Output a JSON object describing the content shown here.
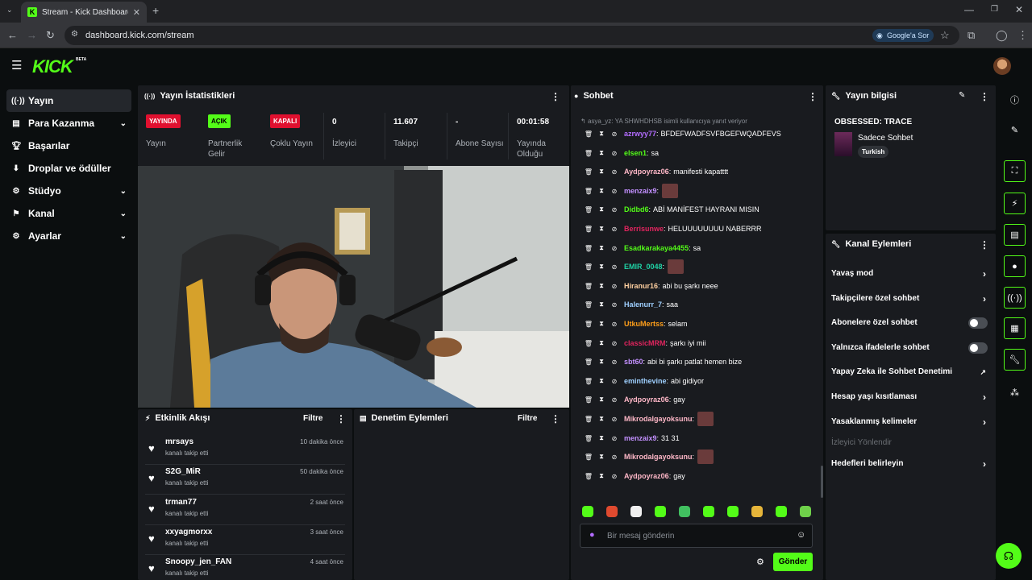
{
  "browser": {
    "tab_title": "Stream - Kick Dashboard",
    "url": "dashboard.kick.com/stream",
    "google_sor": "Google'a Sor"
  },
  "app": {
    "logo": "KICK",
    "beta": "BETA"
  },
  "sidebar": {
    "items": [
      {
        "label": "Yayın",
        "icon": "broadcast-icon"
      },
      {
        "label": "Para Kazanma",
        "icon": "money-icon"
      },
      {
        "label": "Başarılar",
        "icon": "trophy-icon"
      },
      {
        "label": "Droplar ve ödüller",
        "icon": "drops-icon"
      },
      {
        "label": "Stüdyo",
        "icon": "studio-icon"
      },
      {
        "label": "Kanal",
        "icon": "channel-icon"
      },
      {
        "label": "Ayarlar",
        "icon": "gear-icon"
      }
    ]
  },
  "stats": {
    "title": "Yayın İstatistikleri",
    "live_badge": "YAYINDA",
    "live_label": "Yayın",
    "partner_badge": "AÇIK",
    "partner_label": "Partnerlik Gelir",
    "multi_badge": "KAPALI",
    "multi_label": "Çoklu Yayın",
    "viewers": "0",
    "viewers_label": "İzleyici",
    "followers": "11.607",
    "followers_label": "Takipçi",
    "subs": "-",
    "subs_label": "Abone Sayısı",
    "uptime": "00:01:58",
    "uptime_label": "Yayında Olduğu"
  },
  "activity": {
    "title": "Etkinlik Akışı",
    "filter": "Filtre",
    "items": [
      {
        "name": "mrsays",
        "sub": "kanalı takip etti",
        "time": "10 dakika önce"
      },
      {
        "name": "S2G_MiR",
        "sub": "kanalı takip etti",
        "time": "50 dakika önce"
      },
      {
        "name": "trman77",
        "sub": "kanalı takip etti",
        "time": "2 saat önce"
      },
      {
        "name": "xxyagmorxx",
        "sub": "kanalı takip etti",
        "time": "3 saat önce"
      },
      {
        "name": "Snoopy_jen_FAN",
        "sub": "kanalı takip etti",
        "time": "4 saat önce"
      }
    ]
  },
  "moderation": {
    "title": "Denetim Eylemleri",
    "filter": "Filtre"
  },
  "chat": {
    "title": "Sohbet",
    "reply_note": "asya_yz: YA SHWHDHSB isimli kullanıcıya yanıt veriyor",
    "messages": [
      {
        "user": "azrwyy77",
        "text": "BFDEFWADFSVFBGEFWQADFEVS",
        "color": "#b36cff"
      },
      {
        "user": "elsen1",
        "text": "sa",
        "color": "#53fc18"
      },
      {
        "user": "Aydpoyraz06",
        "text": "manifesti kapatttt",
        "color": "#ffb8c8"
      },
      {
        "user": "menzaix9",
        "text": "",
        "color": "#c390ff"
      },
      {
        "user": "Didbd6",
        "text": "ABİ MANİFEST HAYRANI MISIN",
        "color": "#53fc18"
      },
      {
        "user": "Berrisunwe",
        "text": "HELUUUUUUUU NABERRR",
        "color": "#e0245e"
      },
      {
        "user": "Esadkarakaya4455",
        "text": "sa",
        "color": "#53fc18"
      },
      {
        "user": "EMIR_0048",
        "text": "",
        "color": "#1fd1a5"
      },
      {
        "user": "Hiranur16",
        "text": "abi bu şarkı neee",
        "color": "#ffd0a0"
      },
      {
        "user": "Halenurr_7",
        "text": "saa",
        "color": "#9fd0ff"
      },
      {
        "user": "UtkuMertss",
        "text": "selam",
        "color": "#ff9f1a"
      },
      {
        "user": "classicMRM",
        "text": "şarkı iyi mii",
        "color": "#e0245e"
      },
      {
        "user": "sbt60",
        "text": "abi bi şarkı patlat hemen bize",
        "color": "#c390ff"
      },
      {
        "user": "eminthevine",
        "text": "abi gidiyor",
        "color": "#9fd0ff"
      },
      {
        "user": "Aydpoyraz06",
        "text": "gay",
        "color": "#ffb8c8"
      },
      {
        "user": "Mikrodalgayoksunu",
        "text": "",
        "color": "#ffb8c8"
      },
      {
        "user": "menzaix9",
        "text": "31 31",
        "color": "#c390ff"
      },
      {
        "user": "Mikrodalgayoksunu",
        "text": "",
        "color": "#ffb8c8"
      },
      {
        "user": "Aydpoyraz06",
        "text": "gay",
        "color": "#ffb8c8"
      }
    ],
    "placeholder": "Bir mesaj gönderin",
    "send": "Gönder"
  },
  "stream_info": {
    "title": "Yayın bilgisi",
    "stream_title": "OBSESSED: TRACE",
    "category": "Sadece Sohbet",
    "tag": "Turkish"
  },
  "channel_actions": {
    "title": "Kanal Eylemleri",
    "items": [
      {
        "label": "Yavaş mod"
      },
      {
        "label": "Takipçilere özel sohbet"
      },
      {
        "label": "Abonelere özel sohbet"
      },
      {
        "label": "Yalnızca ifadelerle sohbet"
      },
      {
        "label": "Yapay Zeka ile Sohbet Denetimi"
      },
      {
        "label": "Hesap yaşı kısıtlaması"
      },
      {
        "label": "Yasaklanmış kelimeler"
      },
      {
        "label": "İzleyici Yönlendir"
      },
      {
        "label": "Hedefleri belirleyin"
      }
    ]
  },
  "colors": {
    "accent": "#53fc18",
    "live_red": "#e0102f",
    "panel": "#191b1f"
  }
}
